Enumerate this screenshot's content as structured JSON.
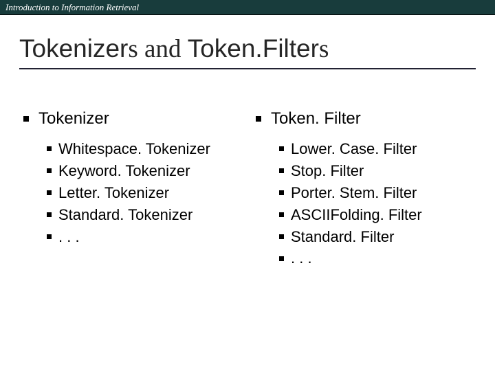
{
  "header": {
    "course": "Introduction to Information Retrieval"
  },
  "title": {
    "part1": "Tokenizer",
    "part2": "s",
    "part3": " and ",
    "part4": "Token.Filter",
    "part5": "s"
  },
  "left": {
    "heading": "Tokenizer",
    "items": [
      "Whitespace. Tokenizer",
      "Keyword. Tokenizer",
      "Letter. Tokenizer",
      "Standard. Tokenizer",
      ". . ."
    ]
  },
  "right": {
    "heading": "Token. Filter",
    "items": [
      "Lower. Case. Filter",
      "Stop. Filter",
      "Porter. Stem. Filter",
      "ASCIIFolding. Filter",
      "Standard. Filter",
      ". . ."
    ]
  }
}
